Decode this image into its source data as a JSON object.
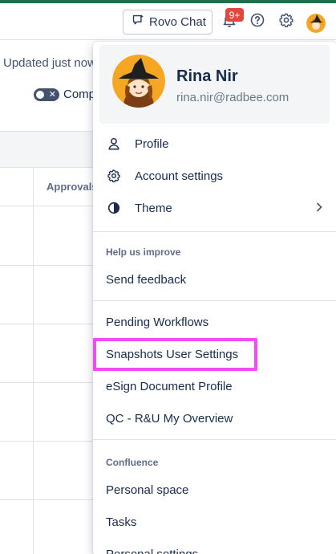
{
  "topbar": {
    "rovo_label": "Rovo Chat",
    "notification_count": "9+"
  },
  "background": {
    "updated_text": "Updated just now",
    "toggle_label": "Comp",
    "approvals_header": "Approvals"
  },
  "profile": {
    "name": "Rina Nir",
    "email": "rina.nir@radbee.com"
  },
  "menu": {
    "primary": [
      {
        "label": "Profile",
        "icon": "person-icon"
      },
      {
        "label": "Account settings",
        "icon": "gear-icon"
      },
      {
        "label": "Theme",
        "icon": "theme-icon"
      }
    ],
    "help_title": "Help us improve",
    "send_feedback": "Send feedback",
    "apps": [
      {
        "label": "Pending Workflows"
      },
      {
        "label": "Snapshots User Settings"
      },
      {
        "label": "eSign Document Profile"
      },
      {
        "label": "QC - R&U My Overview"
      }
    ],
    "confluence_title": "Confluence",
    "confluence": [
      {
        "label": "Personal space"
      },
      {
        "label": "Tasks"
      },
      {
        "label": "Personal settings"
      }
    ]
  },
  "colors": {
    "brand_strip": "#216e4e",
    "notification_badge": "#e2483d",
    "highlight": "#f54bf7"
  }
}
